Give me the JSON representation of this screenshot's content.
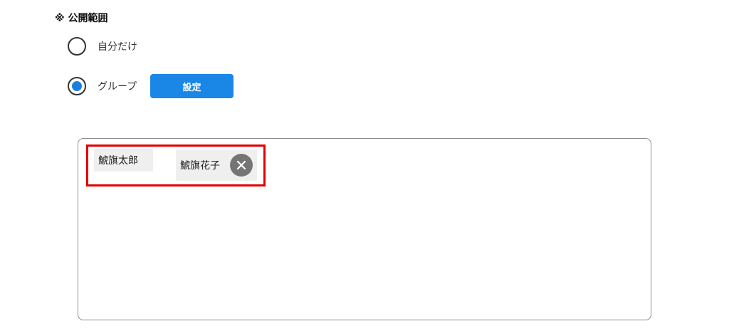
{
  "visibility": {
    "title": "※ 公開範囲",
    "options": [
      {
        "label": "自分だけ",
        "selected": false
      },
      {
        "label": "グループ",
        "selected": true
      }
    ],
    "settings_button_label": "設定"
  },
  "members": {
    "chips": [
      {
        "name": "鯱旗太郎",
        "removable": false
      },
      {
        "name": "鯱旗花子",
        "removable": true
      }
    ]
  },
  "colors": {
    "accent": "#1a86e6",
    "radio_selected": "#1a7fe0",
    "highlight": "#e50000",
    "chip_bg": "#efefef",
    "remove_button": "#757575"
  },
  "icons": {
    "remove": "close-icon"
  }
}
